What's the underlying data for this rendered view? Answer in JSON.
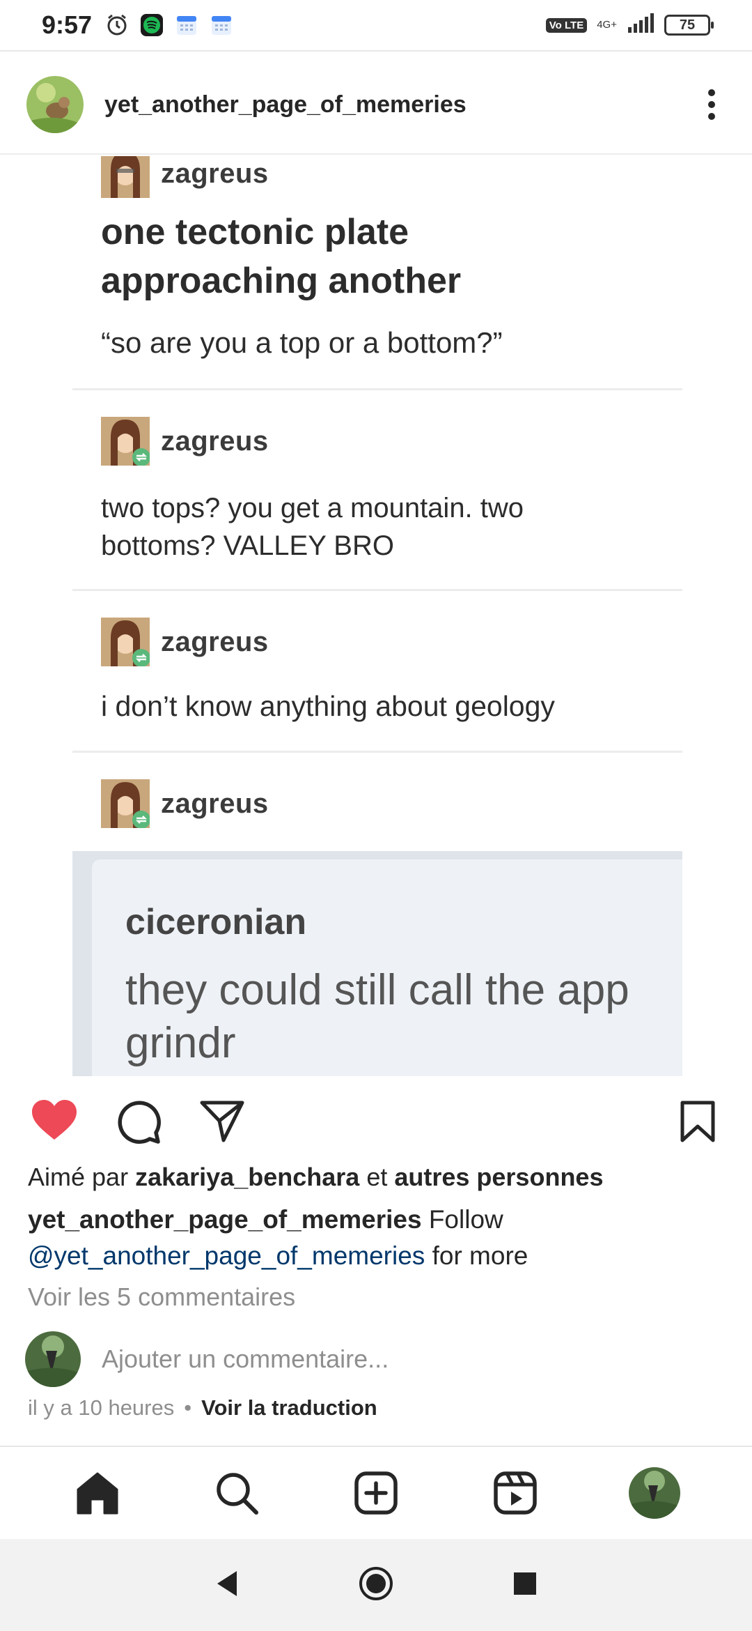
{
  "status_bar": {
    "time": "9:57",
    "volte": "Vo LTE",
    "network": "4G+",
    "battery": "75"
  },
  "post": {
    "username": "yet_another_page_of_memeries",
    "image": {
      "entries": [
        {
          "user": "zagreus",
          "text": "one tectonic plate approaching another",
          "subtext": "“so are you a top or a bottom?”"
        },
        {
          "user": "zagreus",
          "text": "two tops? you get a mountain. two bottoms? VALLEY BRO"
        },
        {
          "user": "zagreus",
          "text": "i don’t know anything about geology"
        },
        {
          "user": "zagreus",
          "quote_user": "ciceronian",
          "quote_text": "they could still call the app grindr"
        }
      ]
    },
    "likes": {
      "prefix": "Aimé par",
      "user": "zakariya_benchara",
      "connector": "et",
      "others": "autres personnes"
    },
    "caption": {
      "user": "yet_another_page_of_memeries",
      "text1": "Follow",
      "mention": "@yet_another_page_of_memeries",
      "text2": "for more"
    },
    "view_comments": "Voir les 5 commentaires",
    "add_comment_placeholder": "Ajouter un commentaire...",
    "time_ago": "il y a 10 heures",
    "separator": "•",
    "translate": "Voir la traduction"
  },
  "colors": {
    "like_red": "#ed4956",
    "mention_blue": "#00376b",
    "retumblr_green": "#5bb87b"
  },
  "icons": [
    "alarm-icon",
    "spotify-icon",
    "calendar-icon",
    "signal-icon",
    "battery-icon",
    "more-options-icon",
    "heart-icon",
    "comment-icon",
    "share-icon",
    "bookmark-icon",
    "home-icon",
    "search-icon",
    "create-icon",
    "reels-icon",
    "profile-icon",
    "back-icon",
    "home-circle-icon",
    "recents-icon"
  ]
}
